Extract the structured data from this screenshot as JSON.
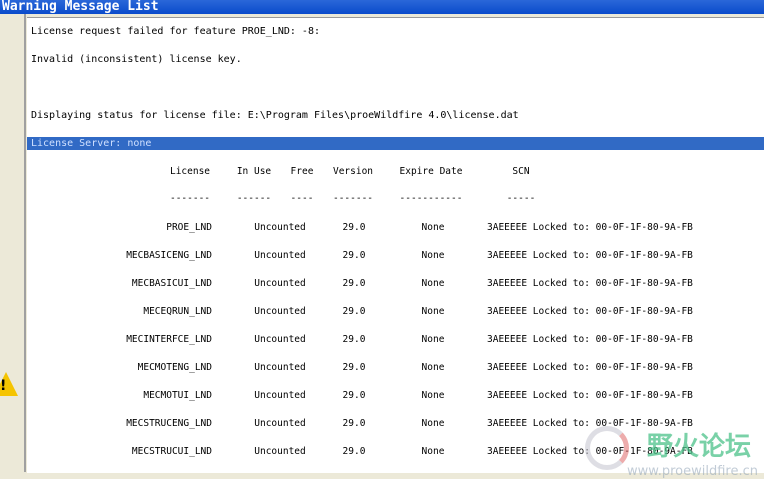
{
  "window": {
    "title": "Warning Message List"
  },
  "messages": [
    "License request failed for feature PROE_LND: -8:",
    "Invalid (inconsistent) license key.",
    "Displaying status for license file: E:\\Program Files\\proeWildfire 4.0\\license.dat"
  ],
  "server_line": "License Server: none",
  "table": {
    "headers": [
      "License",
      "In Use",
      "Free",
      "Version",
      "Expire Date",
      "SCN"
    ],
    "dashes": [
      "-------",
      "------",
      "----",
      "-------",
      "-----------",
      "-----"
    ],
    "rows": [
      [
        "PROE_LND",
        "Uncounted",
        "29.0",
        "None",
        "3AEEEEE Locked to: 00-0F-1F-80-9A-FB"
      ],
      [
        "MECBASICENG_LND",
        "Uncounted",
        "29.0",
        "None",
        "3AEEEEE Locked to: 00-0F-1F-80-9A-FB"
      ],
      [
        "MECBASICUI_LND",
        "Uncounted",
        "29.0",
        "None",
        "3AEEEEE Locked to: 00-0F-1F-80-9A-FB"
      ],
      [
        "MECEQRUN_LND",
        "Uncounted",
        "29.0",
        "None",
        "3AEEEEE Locked to: 00-0F-1F-80-9A-FB"
      ],
      [
        "MECINTERFCE_LND",
        "Uncounted",
        "29.0",
        "None",
        "3AEEEEE Locked to: 00-0F-1F-80-9A-FB"
      ],
      [
        "MECMOTENG_LND",
        "Uncounted",
        "29.0",
        "None",
        "3AEEEEE Locked to: 00-0F-1F-80-9A-FB"
      ],
      [
        "MECMOTUI_LND",
        "Uncounted",
        "29.0",
        "None",
        "3AEEEEE Locked to: 00-0F-1F-80-9A-FB"
      ],
      [
        "MECSTRUCENG_LND",
        "Uncounted",
        "29.0",
        "None",
        "3AEEEEE Locked to: 00-0F-1F-80-9A-FB"
      ],
      [
        "MECSTRUCUI_LND",
        "Uncounted",
        "29.0",
        "None",
        "3AEEEEE Locked to: 00-0F-1F-80-9A-FB"
      ]
    ]
  },
  "watermark": {
    "text": "野火论坛",
    "url": "www.proewildfire.cn"
  }
}
